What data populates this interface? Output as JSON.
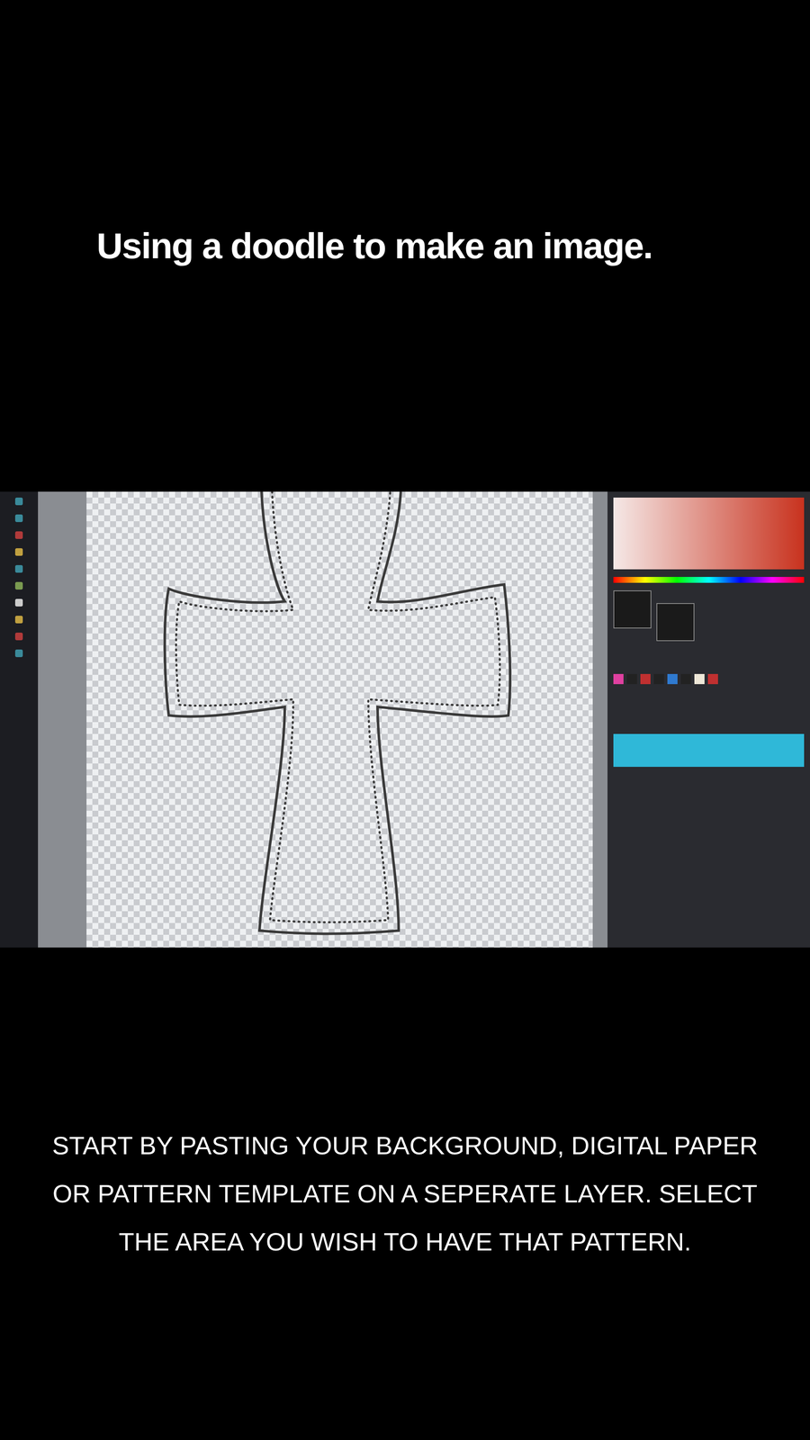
{
  "title": "Using a doodle to make an image.",
  "photo": {
    "kind": "screen-photo"
  },
  "caption": "START BY PASTING YOUR BACKGROUND, DIGITAL PAPER OR PATTERN TEMPLATE ON A SEPERATE LAYER. SELECT THE AREA YOU WISH TO HAVE THAT PATTERN."
}
